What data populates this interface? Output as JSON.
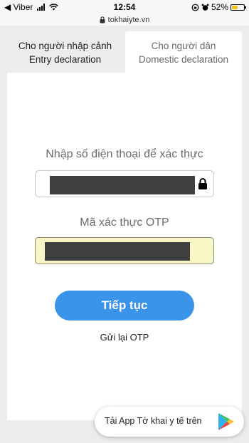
{
  "status_bar": {
    "back_app": "◀ Viber",
    "time": "12:54",
    "battery_percent": "52%",
    "battery_level": 0.52
  },
  "browser": {
    "url": "tokhaiyte.vn"
  },
  "tabs": [
    {
      "line1": "Cho người nhập cảnh",
      "line2": "Entry declaration",
      "active": false
    },
    {
      "line1": "Cho người dân",
      "line2": "Domestic declaration",
      "active": true
    }
  ],
  "form": {
    "phone_label": "Nhập số điện thoại để xác thực",
    "otp_label": "Mã xác thực OTP",
    "continue_label": "Tiếp tục",
    "resend_label": "Gửi lại OTP"
  },
  "banner": {
    "text": "Tải App Tờ khai y tế trên",
    "icon": "google-play-icon"
  },
  "colors": {
    "accent": "#3a95ea",
    "otp_field_bg": "#faf7c6",
    "masked_value": "#3f3f3f"
  }
}
